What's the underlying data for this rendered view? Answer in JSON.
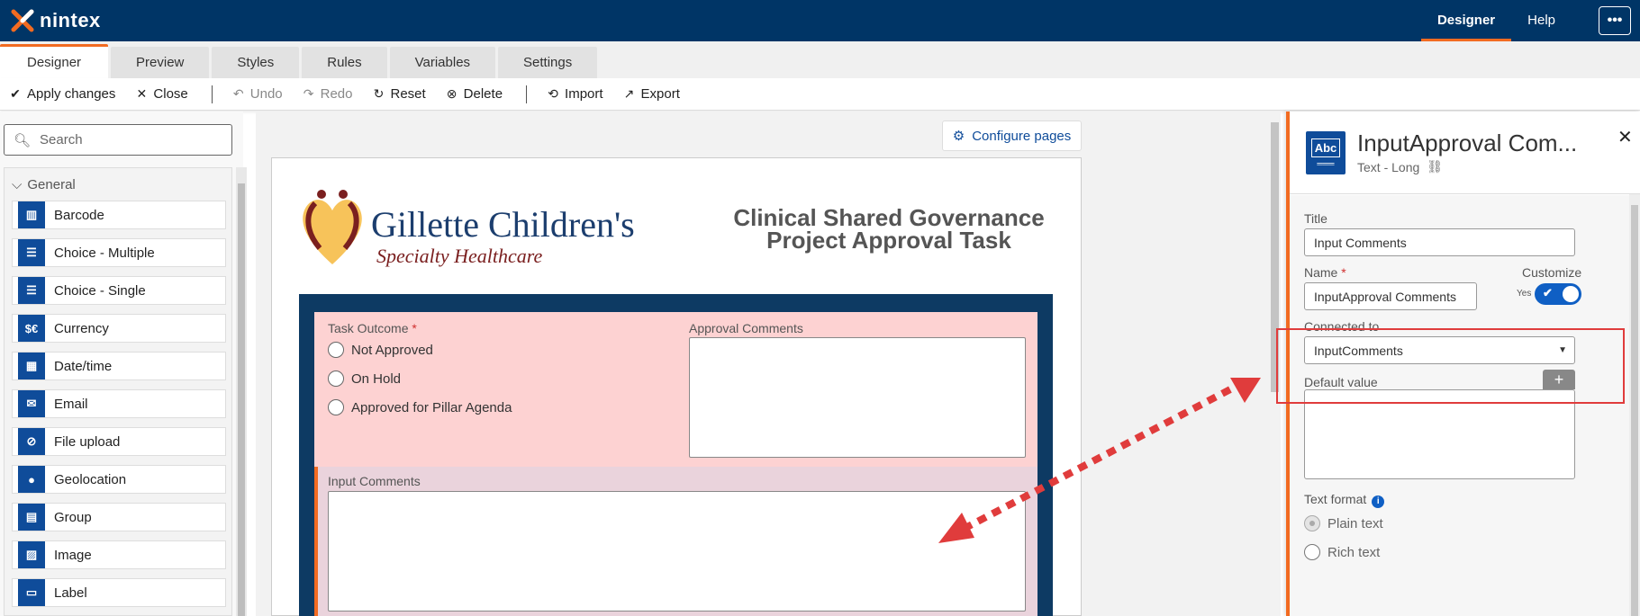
{
  "app": {
    "brand": "nintex"
  },
  "topnav": {
    "designer": "Designer",
    "help": "Help",
    "more": "•••"
  },
  "tabs": [
    "Designer",
    "Preview",
    "Styles",
    "Rules",
    "Variables",
    "Settings"
  ],
  "toolbar": {
    "apply": "Apply changes",
    "close": "Close",
    "undo": "Undo",
    "redo": "Redo",
    "reset": "Reset",
    "delete": "Delete",
    "import": "Import",
    "export": "Export"
  },
  "leftpanel": {
    "search_placeholder": "Search",
    "group": "General",
    "items": [
      {
        "label": "Barcode",
        "icon": "barcode-icon",
        "glyph": "▥"
      },
      {
        "label": "Choice - Multiple",
        "icon": "checklist-icon",
        "glyph": "☰"
      },
      {
        "label": "Choice - Single",
        "icon": "radio-list-icon",
        "glyph": "☰"
      },
      {
        "label": "Currency",
        "icon": "currency-icon",
        "glyph": "$€"
      },
      {
        "label": "Date/time",
        "icon": "calendar-icon",
        "glyph": "▦"
      },
      {
        "label": "Email",
        "icon": "envelope-icon",
        "glyph": "✉"
      },
      {
        "label": "File upload",
        "icon": "paperclip-icon",
        "glyph": "⊘"
      },
      {
        "label": "Geolocation",
        "icon": "map-pin-icon",
        "glyph": "●"
      },
      {
        "label": "Group",
        "icon": "group-icon",
        "glyph": "▤"
      },
      {
        "label": "Image",
        "icon": "image-icon",
        "glyph": "▨"
      },
      {
        "label": "Label",
        "icon": "label-icon",
        "glyph": "▭"
      }
    ]
  },
  "canvas": {
    "configure_pages": "Configure pages",
    "org_name": "Gillette Children's",
    "org_sub": "Specialty Healthcare",
    "form_title_line1": "Clinical Shared Governance",
    "form_title_line2": "Project Approval Task",
    "task_outcome_label": "Task Outcome",
    "required_mark": "*",
    "outcomes": [
      "Not Approved",
      "On Hold",
      "Approved for Pillar Agenda"
    ],
    "approval_comments_label": "Approval Comments",
    "input_comments_label": "Input Comments"
  },
  "rightpanel": {
    "title": "InputApproval Com...",
    "subtitle": "Text - Long",
    "close": "✕",
    "title_label": "Title",
    "title_value": "Input Comments",
    "name_label": "Name",
    "name_value": "InputApproval Comments",
    "customize_label": "Customize",
    "customize_state": "Yes",
    "connected_label": "Connected to",
    "connected_value": "InputComments",
    "default_label": "Default value",
    "text_format_label": "Text format",
    "formats": [
      "Plain text",
      "Rich text"
    ],
    "selected_format": "Plain text"
  },
  "colors": {
    "brand_navy": "#003566",
    "accent_orange": "#f26b21",
    "link_blue": "#0f4c9a",
    "annotation_red": "#e03c3c"
  }
}
